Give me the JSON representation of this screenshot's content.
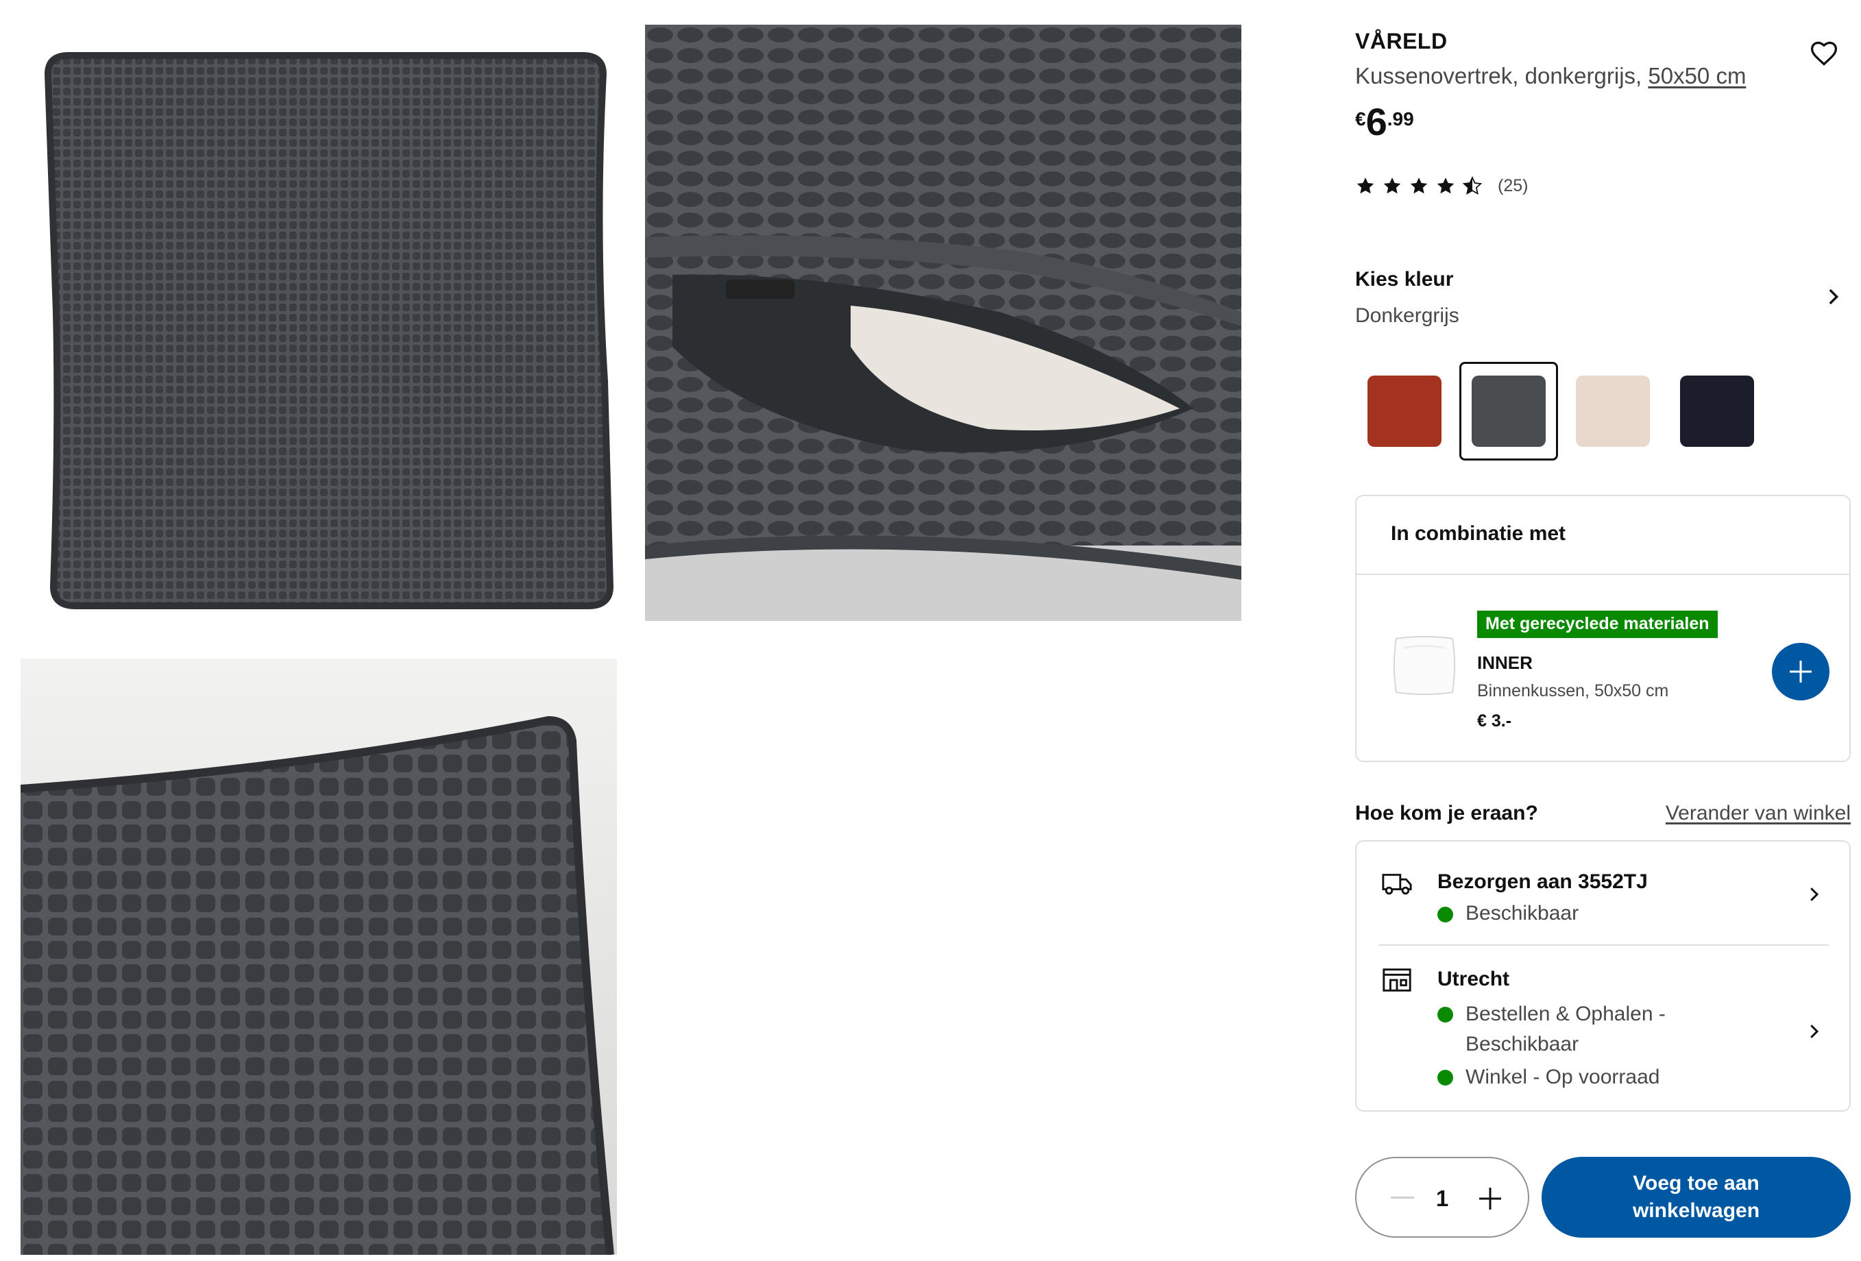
{
  "gallery": {
    "images": [
      {
        "alt": "cushion cover front view",
        "colors": {
          "fabric": "#4a4d50",
          "piping": "#3b3d40"
        }
      },
      {
        "alt": "cushion zipper detail",
        "colors": {
          "fabric": "#3f4246",
          "inner": "#e9e4de"
        }
      },
      {
        "alt": "cushion corner detail",
        "colors": {
          "fabric": "#3a3c40",
          "background": "#e3e3e1"
        }
      }
    ]
  },
  "product": {
    "name": "VÅRELD",
    "description_prefix": "Kussenovertrek, donkergrijs, ",
    "size_link": "50x50 cm",
    "price_currency": "€",
    "price_integer": "6",
    "price_decimal": ".99",
    "rating": {
      "stars": 4.5,
      "count_label": "(25)"
    }
  },
  "color_picker": {
    "title": "Kies kleur",
    "selected_label": "Donkergrijs",
    "swatches": [
      {
        "name": "rood",
        "color": "#a3321f",
        "selected": false
      },
      {
        "name": "donkergrijs",
        "color": "#4a4d50",
        "selected": true
      },
      {
        "name": "beige",
        "color": "#e8d9cc",
        "selected": false
      },
      {
        "name": "donkerblauw",
        "color": "#1b1e2a",
        "selected": false
      }
    ]
  },
  "combination": {
    "title": "In combinatie met",
    "badge": "Met gerecyclede materialen",
    "name": "INNER",
    "description": "Binnenkussen, 50x50 cm",
    "price": "€ 3.-"
  },
  "availability": {
    "title": "Hoe kom je eraan?",
    "change_store": "Verander van winkel",
    "delivery": {
      "title": "Bezorgen aan 3552TJ",
      "status": "Beschikbaar"
    },
    "store": {
      "title": "Utrecht",
      "status_1": "Bestellen & Ophalen - Beschikbaar",
      "status_2": "Winkel - Op voorraad"
    }
  },
  "cart": {
    "quantity": "1",
    "add_button": "Voeg toe aan winkelwagen"
  },
  "theme": {
    "accent": "#0058a3",
    "success": "#0a8a00"
  }
}
